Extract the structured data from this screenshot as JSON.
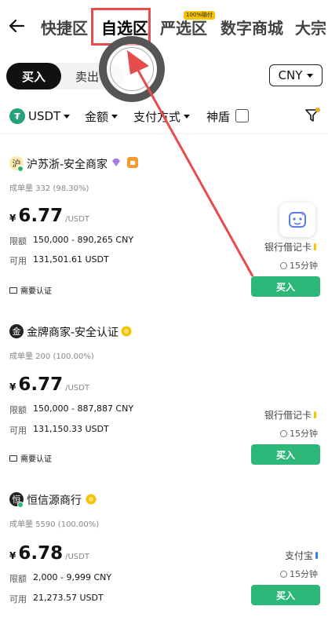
{
  "tabs": [
    "快捷区",
    "自选区",
    "严选区",
    "数字商城",
    "大宗"
  ],
  "tab_badge": "100%赔付",
  "trade": {
    "buy": "买入",
    "sell": "卖出"
  },
  "currency": "CNY",
  "filters": {
    "coin": "USDT",
    "amount": "金额",
    "payment": "支付方式",
    "shield": "神盾"
  },
  "merchants": [
    {
      "avatar": "沪",
      "name": "沪苏浙-安全商家",
      "orders": "成单量 332 (98.30%)",
      "currency_symbol": "¥",
      "price": "6.77",
      "unit": "/USDT",
      "limit_label": "限额",
      "limit": "150,000 - 890,265 CNY",
      "avail_label": "可用",
      "available": "131,501.61 USDT",
      "payment": "银行借记卡",
      "time": "15分钟",
      "verify": "需要认证",
      "action": "买入"
    },
    {
      "avatar": "金",
      "name": "金牌商家-安全认证",
      "orders": "成单量 200 (100.00%)",
      "currency_symbol": "¥",
      "price": "6.77",
      "unit": "/USDT",
      "limit_label": "限额",
      "limit": "150,000 - 887,887 CNY",
      "avail_label": "可用",
      "available": "131,150.33 USDT",
      "payment": "银行借记卡",
      "time": "15分钟",
      "verify": "需要认证",
      "action": "买入"
    },
    {
      "avatar": "恒",
      "name": "恒信源商行",
      "orders": "成单量 5590 (100.00%)",
      "currency_symbol": "¥",
      "price": "6.78",
      "unit": "/USDT",
      "limit_label": "限额",
      "limit": "2,000 - 9,999 CNY",
      "avail_label": "可用",
      "available": "21,273.57 USDT",
      "payment": "支付宝",
      "time": "15分钟",
      "action": "买入"
    }
  ],
  "colors": {
    "accent_green": "#2db87a",
    "highlight_red": "#e74c4c",
    "tether": "#26a17b"
  }
}
